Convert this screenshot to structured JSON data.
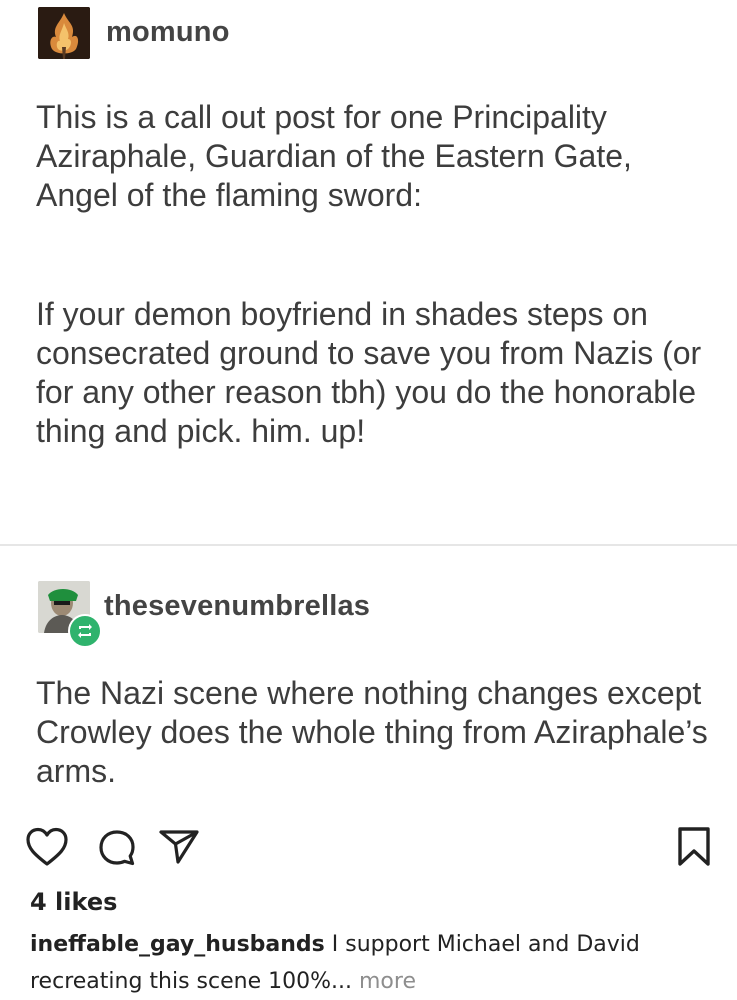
{
  "post": {
    "author": "momuno",
    "paragraphs": [
      "This is a call out post for one Principality Aziraphale, Guardian of the Eastern Gate, Angel of the flaming sword:",
      "If your demon boyfriend in shades steps on consecrated ground to save you from Nazis (or for any other reason tbh) you do the honorable thing and pick. him. up!"
    ]
  },
  "reblog": {
    "author": "thesevenumbrellas",
    "text": "The Nazi scene where nothing changes except Crowley does the whole thing from Aziraphale’s arms."
  },
  "actions": {
    "icons": [
      "heart-icon",
      "comment-icon",
      "share-icon",
      "bookmark-icon"
    ]
  },
  "likes": "4 likes",
  "caption": {
    "user": "ineffable_gay_husbands",
    "text": " I support Michael and David recreating this scene 100%...",
    "more": " more"
  },
  "colors": {
    "reblog_badge": "#2fb36d",
    "divider": "#e6e6e6"
  }
}
